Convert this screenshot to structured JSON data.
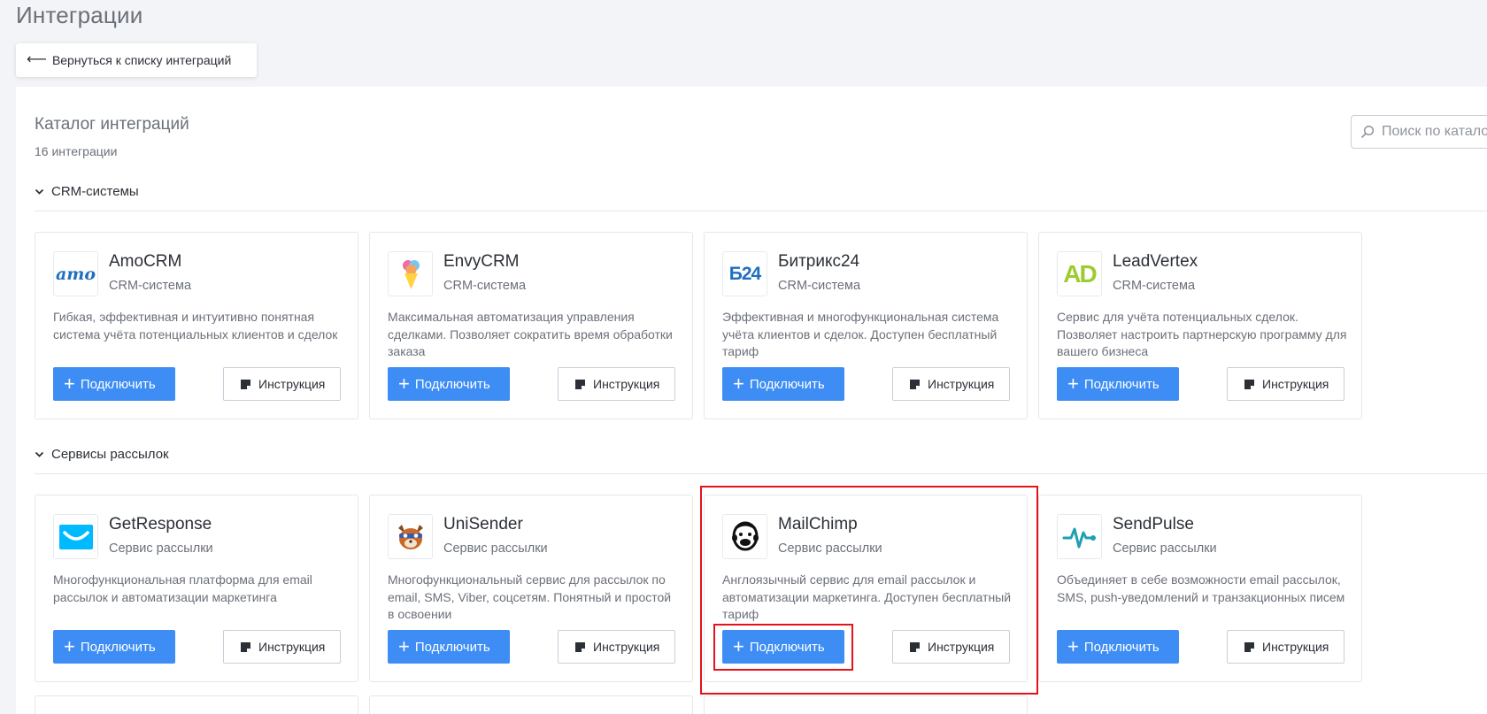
{
  "page": {
    "title": "Интеграции",
    "back_label": "Вернуться к списку интеграций"
  },
  "catalog": {
    "title": "Каталог интеграций",
    "count": "16 интеграции",
    "search_placeholder": "Поиск по каталогу"
  },
  "buttons": {
    "connect": "Подключить",
    "guide": "Инструкция"
  },
  "sections": [
    {
      "title": "CRM-системы",
      "cards": [
        {
          "name": "AmoCRM",
          "type": "CRM-система",
          "description": "Гибкая, эффективная и интуитивно понятная система учёта потенциальных клиентов и сделок",
          "logo_text": "amo"
        },
        {
          "name": "EnvyCRM",
          "type": "CRM-система",
          "description": "Максимальная автоматизация управления сделками. Позволяет сократить время обработки заказа",
          "logo_text": ""
        },
        {
          "name": "Битрикс24",
          "type": "CRM-система",
          "description": "Эффективная и многофункциональная система учёта клиентов и сделок. Доступен бесплатный тариф",
          "logo_text": "Б24"
        },
        {
          "name": "LeadVertex",
          "type": "CRM-система",
          "description": "Сервис для учёта потенциальных сделок. Позволяет настроить партнерскую программу для вашего бизнеса",
          "logo_text": "AD"
        }
      ]
    },
    {
      "title": "Сервисы рассылок",
      "cards": [
        {
          "name": "GetResponse",
          "type": "Сервис рассылки",
          "description": "Многофункциональная платформа для email рассылок и автоматизации маркетинга",
          "logo_text": ""
        },
        {
          "name": "UniSender",
          "type": "Сервис рассылки",
          "description": "Многофункциональный сервис для рассылок по email, SMS, Viber, соцсетям. Понятный и простой в освоении",
          "logo_text": ""
        },
        {
          "name": "MailChimp",
          "type": "Сервис рассылки",
          "description": "Англоязычный сервис для email рассылок и автоматизации маркетинга. Доступен бесплатный тариф",
          "logo_text": ""
        },
        {
          "name": "SendPulse",
          "type": "Сервис рассылки",
          "description": "Объединяет в себе возможности email рассылок, SMS, push-уведомлений и транзакционных писем",
          "logo_text": ""
        }
      ]
    }
  ],
  "colors": {
    "primary": "#3d8df5",
    "highlight": "#e5121b",
    "muted_text": "#6b7078",
    "border": "#e4e7eb"
  },
  "icons": {
    "back": "arrow-left-icon",
    "search": "search-icon",
    "section_toggle": "chevron-down-icon",
    "connect": "plus-icon",
    "guide": "document-icon"
  }
}
